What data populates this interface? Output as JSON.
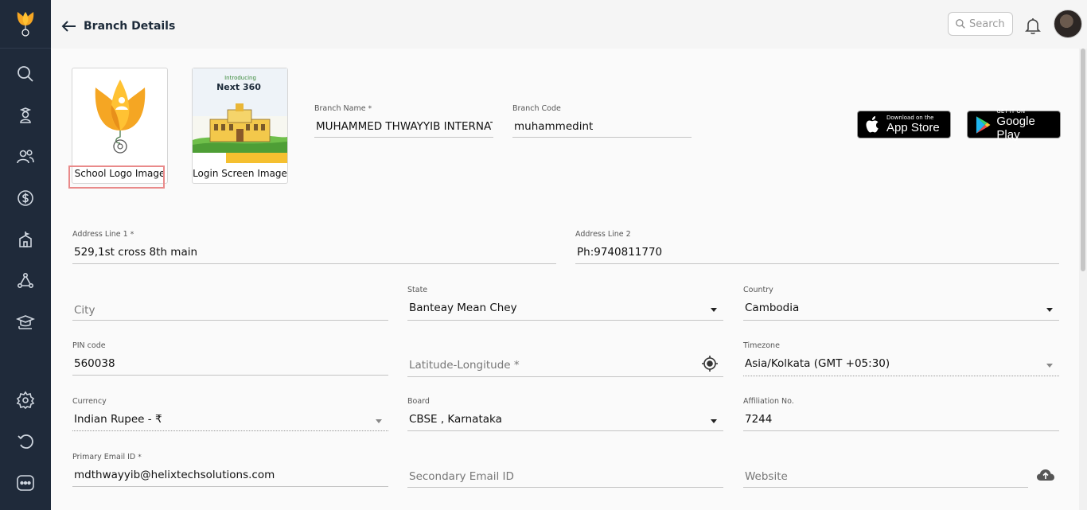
{
  "header": {
    "title": "Branch Details",
    "search_placeholder": "Search"
  },
  "images": {
    "school_logo_caption": "School Logo Image",
    "login_screen_caption": "Login Screen Image",
    "login_screen_texts": {
      "introducing": "Introducing",
      "next": "Next 360"
    }
  },
  "stores": {
    "apple_small": "Download on the",
    "apple_big": "App Store",
    "google_small": "GET IT ON",
    "google_big": "Google Play"
  },
  "form": {
    "branch_name": {
      "label": "Branch Name",
      "value": "MUHAMMED THWAYYIB INTERNATIONAL"
    },
    "branch_code": {
      "label": "Branch Code",
      "value": "muhammedint"
    },
    "address1": {
      "label": "Address Line 1",
      "value": "529,1st cross 8th main"
    },
    "address2": {
      "label": "Address Line 2",
      "value": "Ph:9740811770"
    },
    "city": {
      "placeholder": "City"
    },
    "state": {
      "label": "State",
      "value": "Banteay Mean Chey"
    },
    "country": {
      "label": "Country",
      "value": "Cambodia"
    },
    "pin": {
      "label": "PIN code",
      "value": "560038"
    },
    "latlong": {
      "placeholder": "Latitude-Longitude *"
    },
    "timezone": {
      "label": "Timezone",
      "value": "Asia/Kolkata (GMT +05:30)"
    },
    "currency": {
      "label": "Currency",
      "value": "Indian Rupee - ₹"
    },
    "board": {
      "label": "Board",
      "value": "CBSE , Karnataka"
    },
    "affiliation": {
      "label": "Affiliation No.",
      "value": "7244"
    },
    "primary_email": {
      "label": "Primary Email ID",
      "value": "mdthwayyib@helixtechsolutions.com"
    },
    "secondary_email": {
      "placeholder": "Secondary Email ID"
    },
    "website": {
      "placeholder": "Website"
    }
  },
  "colors": {
    "sidebar": "#1f2a3a",
    "accent_orange": "#f5a623",
    "highlight": "#e98a8a"
  }
}
